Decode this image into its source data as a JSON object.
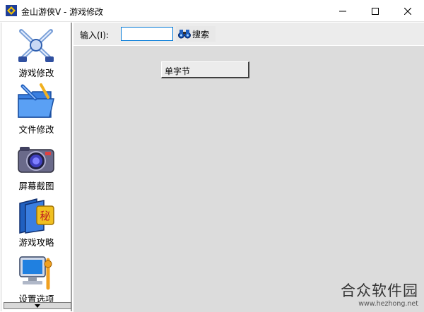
{
  "window": {
    "title": "金山游侠V - 游戏修改"
  },
  "sidebar": {
    "items": [
      {
        "label": "游戏修改",
        "icon": "crossed-swords-icon"
      },
      {
        "label": "文件修改",
        "icon": "folder-pencil-icon"
      },
      {
        "label": "屏幕截图",
        "icon": "camera-icon"
      },
      {
        "label": "游戏攻略",
        "icon": "secret-book-icon"
      },
      {
        "label": "设置选项",
        "icon": "computer-settings-icon"
      }
    ],
    "book_badge": "秘"
  },
  "toolbar": {
    "input_label": "输入(I):",
    "input_value": "",
    "search_label": "搜索"
  },
  "main": {
    "single_byte_label": "单字节"
  },
  "watermark": {
    "title": "合众软件园",
    "url": "www.hezhong.net"
  },
  "colors": {
    "accent": "#0078d7",
    "main_bg": "#dcdcdc",
    "toolbar_bg": "#ececec"
  }
}
